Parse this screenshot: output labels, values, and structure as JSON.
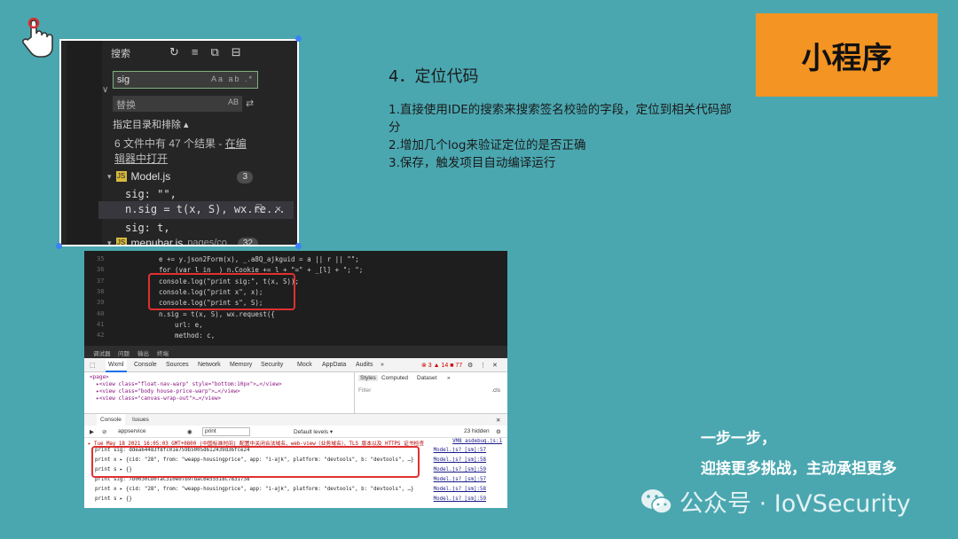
{
  "ide": {
    "title": "搜索",
    "search_value": "sig",
    "search_opts": "Aa ab .*",
    "replace_placeholder": "替换",
    "replace_opts": "AB",
    "filter_label": "指定目录和排除 ▴",
    "summary_prefix": "6 文件中有 47 个结果 - ",
    "summary_link": "在编辑器中打开",
    "file1_name": "Model.js",
    "file1_count": "3",
    "match1": "sig: \"\",",
    "match2": "n.sig = t(x, S), wx.re...",
    "match3": "sig: t,",
    "file2_name": "menubar.js",
    "file2_path": "pages/co...",
    "file2_count": "32"
  },
  "code": {
    "lines": [
      {
        "num": "35",
        "text": "e += y.json2Form(x), _.a8Q_ajkguid = a || r || \"\";"
      },
      {
        "num": "36",
        "text": "for (var l in _) n.Cookie += l + \"=\" + _[l] + \"; \";"
      },
      {
        "num": "37",
        "text": "console.log(\"print sig:\", t(x, S));"
      },
      {
        "num": "38",
        "text": "console.log(\"print x\", x);"
      },
      {
        "num": "39",
        "text": "console.log(\"print s\", S);"
      },
      {
        "num": "40",
        "text": "n.sig = t(x, S), wx.request({"
      },
      {
        "num": "41",
        "text": "    url: e,"
      },
      {
        "num": "42",
        "text": "    method: c,"
      }
    ]
  },
  "devtools": {
    "top_tabs": [
      "调试器",
      "问题",
      "输出",
      "终端"
    ],
    "tabs": [
      "Wxml",
      "Console",
      "Sources",
      "Network",
      "Memory",
      "Security",
      "Mock",
      "AppData",
      "Audits",
      "»"
    ],
    "status": "⊗ 3  ▲ 14  ■ 77",
    "elements": [
      "<page>",
      "  ▸<view class=\"float-nav-warp\" style=\"bottom:10px\">…</view>",
      "  ▸<view class=\"body house-price-warp\">…</view>",
      "  ▸<view class=\"canvas-wrap-out\">…</view>"
    ],
    "styles_tabs": [
      "Styles",
      "Computed",
      "Dataset",
      "»"
    ],
    "styles_filter": "Filter",
    "styles_cls": ".cls",
    "console_tabs": [
      "Console",
      "Issues"
    ],
    "context": "appservice",
    "filter_value": "print",
    "levels": "Default levels ▾",
    "hidden": "23 hidden",
    "console_lines": [
      {
        "text": "▸ Tue May 18 2021 16:05:03 GMT+0800 (中国标准时间) 配置中关闭合法域名、web-view（业务域名）、TLS 版本以及 HTTPS 证书检查",
        "src": "VM8 asdebug.js:1"
      },
      {
        "text": "print sig: ddea64483f8fc01e759b5005d612439d36fce24",
        "src": "Model.js? [sm]:57"
      },
      {
        "text": "print x ▸ {cid: \"28\", from: \"weapp-housingprice\", app: \"i-ajk\", platform: \"devtools\", b: \"devtools\", …}",
        "src": "Model.js? [sm]:58"
      },
      {
        "text": "print s ▸ {}",
        "src": "Model.js? [sm]:59"
      },
      {
        "text": "print sig: 7b0030cb0fac310e07b9fdac6e55518c7831738",
        "src": "Model.js? [sm]:57"
      },
      {
        "text": "print x ▸ {cid: \"28\", from: \"weapp-housingprice\", app: \"i-ajk\", platform: \"devtools\", b: \"devtools\", …}",
        "src": "Model.js? [sm]:58"
      },
      {
        "text": "print s ▸ {}",
        "src": "Model.js? [sm]:59"
      }
    ]
  },
  "content": {
    "heading": "4．定位代码",
    "steps": [
      "1.直接使用IDE的搜索来搜索签名校验的字段，定位到相关代码部分",
      "2.增加几个log来验证定位的是否正确",
      "3.保存，触发项目自动编译运行"
    ],
    "badge": "小程序",
    "slogan1": "一步一步，",
    "slogan2": "迎接更多挑战，主动承担更多",
    "watermark": "公众号 · IoVSecurity"
  },
  "colors": {
    "background": "#4aa7b0",
    "badge": "#f39423",
    "highlight": "#e03030"
  },
  "icons": [
    "hand-pointer-icon",
    "wechat-icon",
    "refresh-icon",
    "clear-icon",
    "new-file-icon",
    "collapse-icon",
    "js-file-icon",
    "replace-icon",
    "close-icon"
  ]
}
